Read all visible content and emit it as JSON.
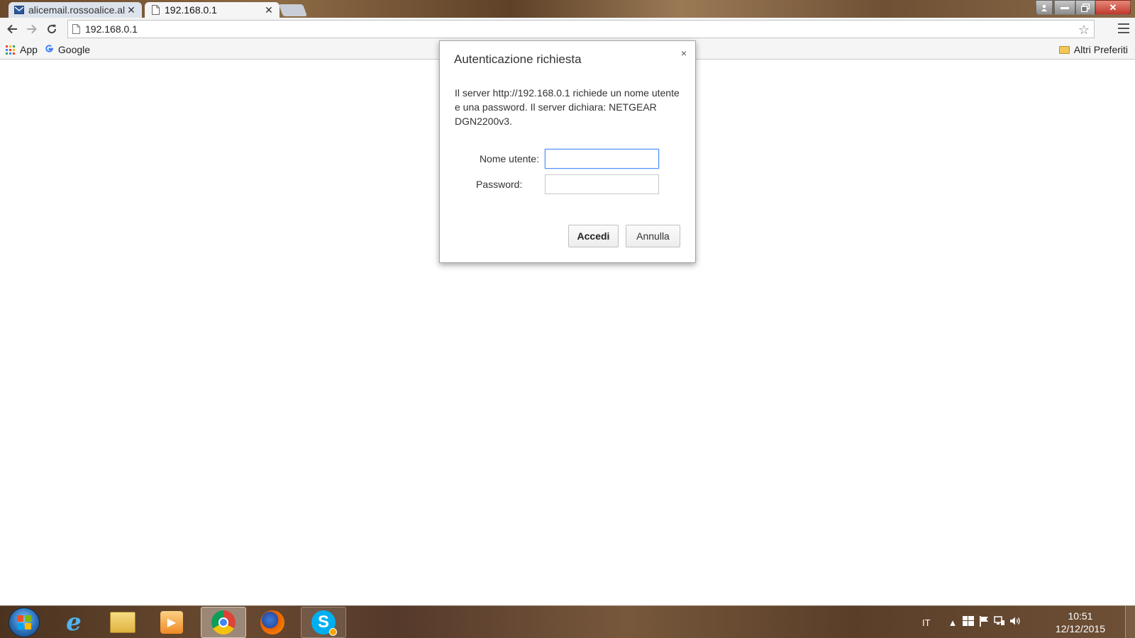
{
  "tabs": [
    {
      "title": "alicemail.rossoalice.al",
      "icon": "mail-icon",
      "active": false
    },
    {
      "title": "192.168.0.1",
      "icon": "page-icon",
      "active": true
    }
  ],
  "toolbar": {
    "url": "192.168.0.1"
  },
  "bookmarks": {
    "apps_label": "App",
    "google_label": "Google",
    "other_label": "Altri Preferiti"
  },
  "dialog": {
    "title": "Autenticazione richiesta",
    "close_glyph": "×",
    "message": "Il server http://192.168.0.1 richiede un nome utente e una password. Il server dichiara: NETGEAR DGN2200v3.",
    "username_label": "Nome utente:",
    "username_value": "",
    "password_label": "Password:",
    "password_value": "",
    "ok_label": "Accedi",
    "cancel_label": "Annulla"
  },
  "taskbar": {
    "apps": [
      "internet-explorer",
      "windows-explorer",
      "media-player",
      "google-chrome",
      "firefox",
      "skype"
    ],
    "active_app": "google-chrome",
    "language": "IT",
    "time": "10:51",
    "date": "12/12/2015"
  },
  "colors": {
    "focus_border": "#4d90fe",
    "close_button": "#c0392b",
    "skype": "#00aff0"
  }
}
